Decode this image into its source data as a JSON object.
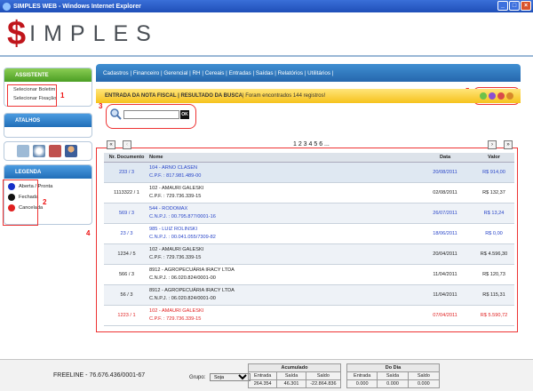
{
  "window": {
    "title": "SIMPLES WEB - Windows Internet Explorer"
  },
  "logo": {
    "s": "$",
    "rest": "IMPLES"
  },
  "menu": [
    "Cadastros | ",
    "Financeiro | ",
    "Gerencial | ",
    "RH | ",
    "Cereais | ",
    "Entradas | ",
    "Saídas | ",
    "Relatórios | ",
    "Utilitários |"
  ],
  "assistente": {
    "title": "ASSISTENTE",
    "items": [
      "Selecionar Boletim",
      "Selecionar Fixação"
    ]
  },
  "atalhos": {
    "title": "ATALHOS"
  },
  "legenda": {
    "title": "LEGENDA",
    "items": [
      {
        "label": "Aberta / Pronta",
        "color": "#1630c8"
      },
      {
        "label": "Fechada",
        "color": "#111111"
      },
      {
        "label": "Cancelada",
        "color": "#e02020"
      }
    ]
  },
  "annotations": [
    "1",
    "2",
    "3",
    "4",
    "5"
  ],
  "banner": {
    "bold": "ENTRADA DA NOTA FISCAL | RESULTADO DA BUSCA",
    "text": " | Foram encontrados 144 registros!"
  },
  "search": {
    "value": "",
    "ok": "OK"
  },
  "pager": {
    "pages": "1 2 3 4 5 6 ..."
  },
  "table": {
    "headers": [
      "Nr. Documento",
      "Nome",
      "Data",
      "Valor"
    ],
    "rows": [
      {
        "doc": "233 / 3",
        "name": "104 - ARNO CLASEN",
        "sub": "C.P.F. : 817.981.489-00",
        "date": "20/08/2011",
        "value": "R$ 914,00",
        "color": "blue"
      },
      {
        "doc": "1113322 / 1",
        "name": "102 - AMAURI GALESKI",
        "sub": "C.P.F. : 729.736.339-15",
        "date": "02/08/2011",
        "value": "R$ 132,37",
        "color": "black"
      },
      {
        "doc": "569 / 3",
        "name": "544 - RODOMAX",
        "sub": "C.N.P.J. : 00.795.877/0001-16",
        "date": "26/07/2011",
        "value": "R$ 13,24",
        "color": "blue"
      },
      {
        "doc": "23 / 3",
        "name": "985 - LUIZ ROLINSKI",
        "sub": "C.N.P.J. : 00.041.055/7309-82",
        "date": "18/06/2011",
        "value": "R$ 0,00",
        "color": "blue"
      },
      {
        "doc": "1234 / 5",
        "name": "102 - AMAURI GALESKI",
        "sub": "C.P.F. : 729.736.339-15",
        "date": "20/04/2011",
        "value": "R$ 4.596,30",
        "color": "black"
      },
      {
        "doc": "566 / 3",
        "name": "8912 - AGROPECUÁRIA IRACY LTDA",
        "sub": "C.N.P.J. : 06.020.824/0001-00",
        "date": "11/04/2011",
        "value": "R$ 120,73",
        "color": "black"
      },
      {
        "doc": "56 / 3",
        "name": "8912 - AGROPECUÁRIA IRACY LTDA",
        "sub": "C.N.P.J. : 06.020.824/0001-00",
        "date": "11/04/2011",
        "value": "R$ 115,31",
        "color": "black"
      },
      {
        "doc": "1223 / 1",
        "name": "102 - AMAURI GALESKI",
        "sub": "C.P.F. : 729.736.339-15",
        "date": "07/04/2011",
        "value": "R$ 5.590,72",
        "color": "red"
      }
    ]
  },
  "footer": {
    "freeline": "FREELINE - 76.676.436/0001-67",
    "grupo_label": "Grupo:",
    "grupo_value": "Soja",
    "acumulado": {
      "title": "Acumulado",
      "cols": [
        "Entrada",
        "Saída",
        "Saldo"
      ],
      "vals": [
        "264.354",
        "46.301",
        "-22.864.836"
      ]
    },
    "dodia": {
      "title": "Do Dia",
      "cols": [
        "Entrada",
        "Saída",
        "Saldo"
      ],
      "vals": [
        "0.000",
        "0.000",
        "0.000"
      ]
    }
  }
}
